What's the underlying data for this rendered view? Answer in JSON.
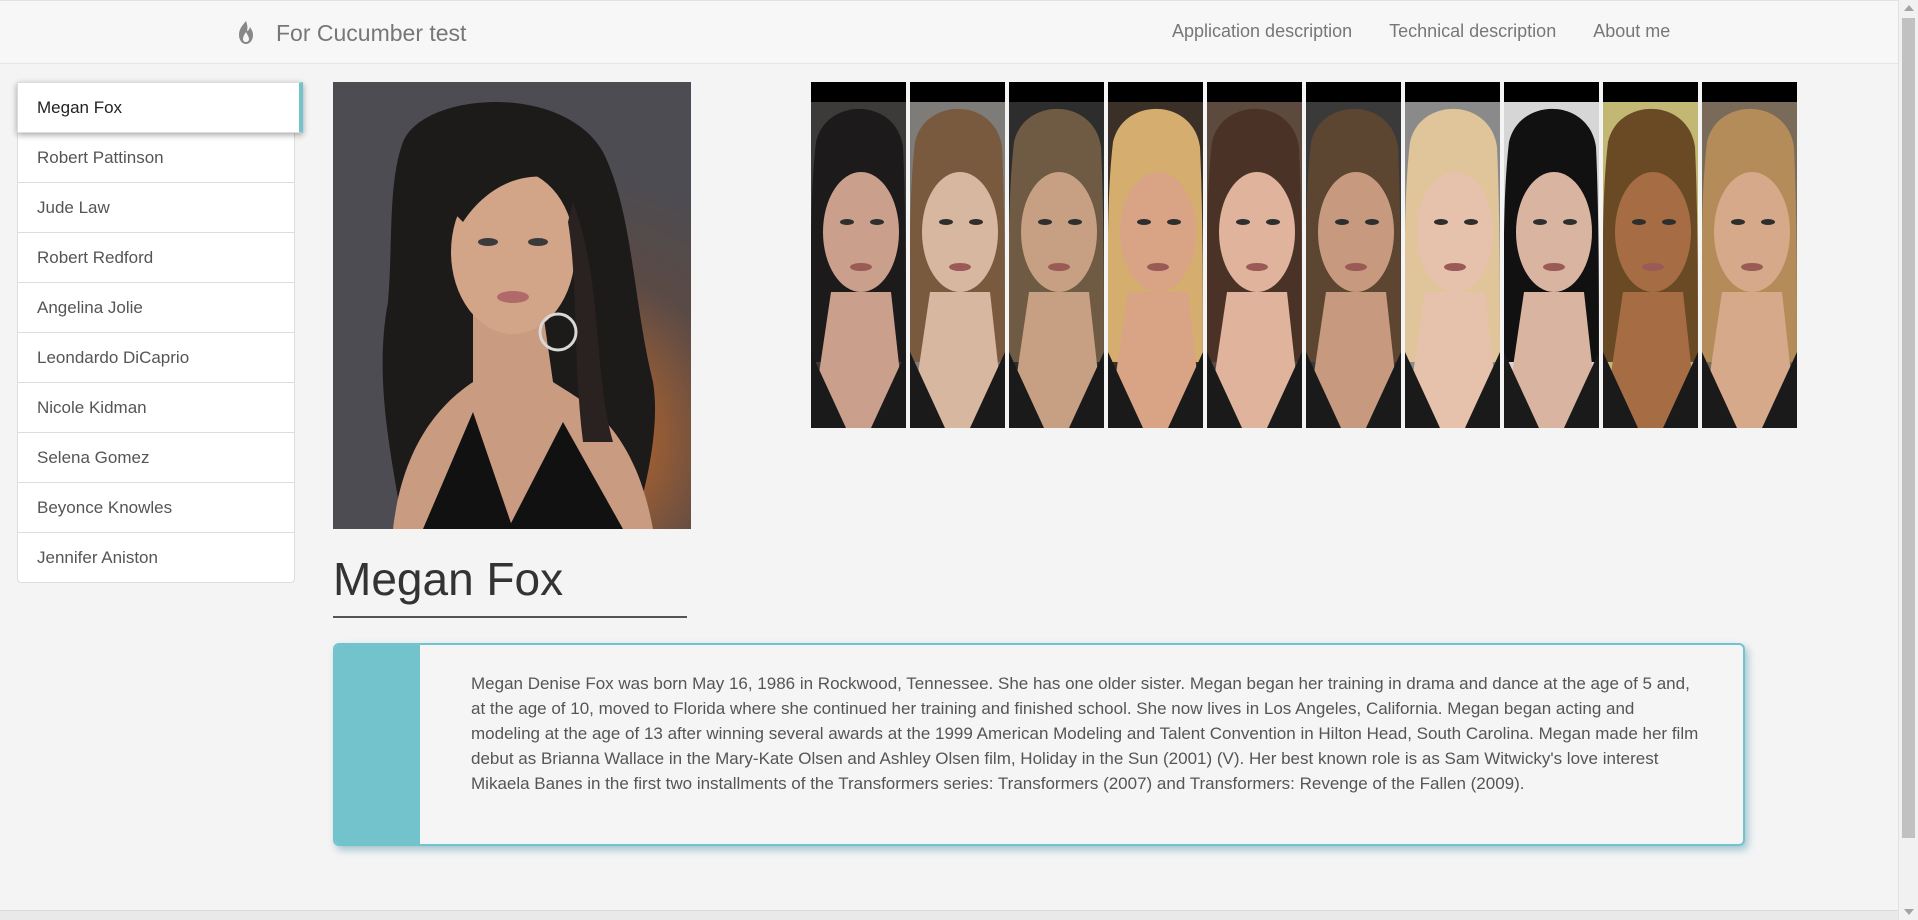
{
  "navbar": {
    "brand_icon": "fire-icon",
    "brand": "For Cucumber test",
    "links": [
      "Application description",
      "Technical description",
      "About me"
    ]
  },
  "sidebar": {
    "items": [
      {
        "label": "Megan Fox",
        "active": true
      },
      {
        "label": "Robert Pattinson",
        "active": false
      },
      {
        "label": "Jude Law",
        "active": false
      },
      {
        "label": "Robert Redford",
        "active": false
      },
      {
        "label": "Angelina Jolie",
        "active": false
      },
      {
        "label": "Leondardo DiCaprio",
        "active": false
      },
      {
        "label": "Nicole Kidman",
        "active": false
      },
      {
        "label": "Selena Gomez",
        "active": false
      },
      {
        "label": "Beyonce Knowles",
        "active": false
      },
      {
        "label": "Jennifer Aniston",
        "active": false
      }
    ]
  },
  "main_photo": {
    "icon": "portrait-photo"
  },
  "thumbnails": [
    {
      "icon": "portrait-thumbnail",
      "tone": "#caa08c",
      "hair": "#1c1a1a",
      "bg": "#3d3b3a"
    },
    {
      "icon": "portrait-thumbnail",
      "tone": "#d8b7a0",
      "hair": "#7a5a3f",
      "bg": "#7e7c78"
    },
    {
      "icon": "portrait-thumbnail",
      "tone": "#c79f82",
      "hair": "#6f5a44",
      "bg": "#2d2d2d"
    },
    {
      "icon": "portrait-thumbnail",
      "tone": "#d9a486",
      "hair": "#d5ad6e",
      "bg": "#3a3028"
    },
    {
      "icon": "portrait-thumbnail",
      "tone": "#e0b39d",
      "hair": "#4a3326",
      "bg": "#5b4a3d"
    },
    {
      "icon": "portrait-thumbnail",
      "tone": "#c79a7f",
      "hair": "#5c4632",
      "bg": "#3a3a3a"
    },
    {
      "icon": "portrait-thumbnail",
      "tone": "#e6c2ac",
      "hair": "#e0c49a",
      "bg": "#8a8a8a"
    },
    {
      "icon": "portrait-thumbnail",
      "tone": "#d9b4a1",
      "hair": "#111111",
      "bg": "#d6d6d6"
    },
    {
      "icon": "portrait-thumbnail",
      "tone": "#a66d44",
      "hair": "#6a4a25",
      "bg": "#c3b774"
    },
    {
      "icon": "portrait-thumbnail",
      "tone": "#d6a98a",
      "hair": "#b48c5a",
      "bg": "#7a6a5a"
    }
  ],
  "person": {
    "name": "Megan Fox",
    "description": "Megan Denise Fox was born May 16, 1986 in Rockwood, Tennessee. She has one older sister. Megan began her training in drama and dance at the age of 5 and, at the age of 10, moved to Florida where she continued her training and finished school. She now lives in Los Angeles, California. Megan began acting and modeling at the age of 13 after winning several awards at the 1999 American Modeling and Talent Convention in Hilton Head, South Carolina. Megan made her film debut as Brianna Wallace in the Mary-Kate Olsen and Ashley Olsen film, Holiday in the Sun (2001) (V). Her best known role is as Sam Witwicky's love interest Mikaela Banes in the first two installments of the Transformers series: Transformers (2007) and Transformers: Revenge of the Fallen (2009)."
  },
  "colors": {
    "accent": "#73c3cd",
    "background": "#f4f4f5",
    "text": "#555555"
  }
}
